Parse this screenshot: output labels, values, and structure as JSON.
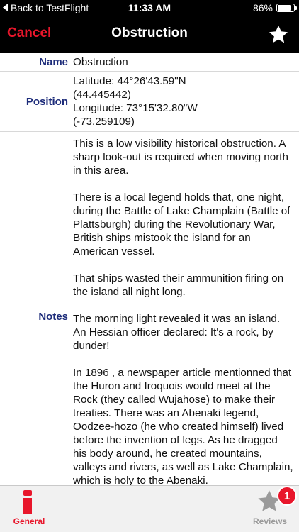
{
  "status_bar": {
    "back_label": "Back to TestFlight",
    "time": "11:33 AM",
    "battery_text": "86%",
    "battery_level": 0.86
  },
  "nav": {
    "cancel_label": "Cancel",
    "title": "Obstruction",
    "favorite_icon": "star-icon"
  },
  "details": {
    "name_label": "Name",
    "name_value": "Obstruction",
    "position_label": "Position",
    "position_lines": [
      "Latitude: 44°26'43.59\"N",
      "(44.445442)",
      "Longitude: 73°15'32.80\"W",
      "(-73.259109)"
    ],
    "notes_label": "Notes",
    "notes_paragraphs": [
      "This is a low visibility historical obstruction. A sharp look-out is required when moving north in this area.",
      "There is a local legend holds that, one night, during the Battle of Lake Champlain (Battle of Plattsburgh) during the Revolutionary War, British ships mistook the island for an American vessel.",
      "That ships wasted their ammunition firing on the island all night long.",
      "The morning light revealed it was an island. An Hessian officer declared: It's a rock, by dunder!",
      "In 1896 , a newspaper article mentionned that the Huron and Iroquois would meet at the Rock (they called Wujahose) to make their treaties.  There was an Abenaki legend, Oodzee-hozo (he who created himself) lived before the invention of legs. As he dragged his body around, he created mountains, valleys and rivers, as well as Lake Champlain, which is holy to the Abenaki."
    ]
  },
  "tabbar": {
    "general_label": "General",
    "reviews_label": "Reviews",
    "reviews_badge": "1",
    "accent_color": "#e8162b",
    "inactive_color": "#9a9a9a"
  }
}
